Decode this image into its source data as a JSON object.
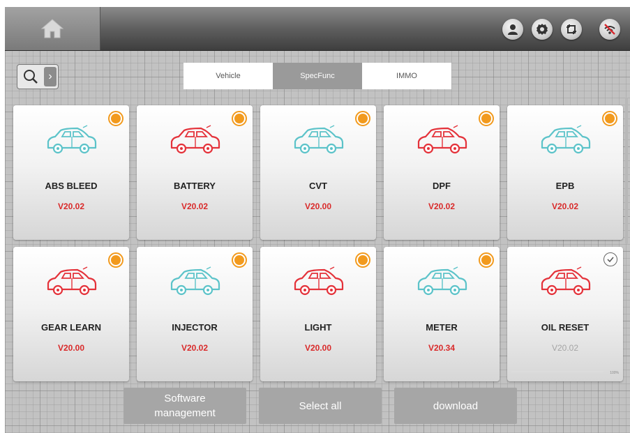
{
  "topbar": {
    "home_icon": "home-icon",
    "icons": [
      "user-icon",
      "gear-icon",
      "screen-capture-icon",
      "wifi-off-icon"
    ]
  },
  "search": {
    "icon": "search-icon",
    "expand_icon": "chevron-right-icon"
  },
  "tabs": [
    {
      "label": "Vehicle",
      "active": false
    },
    {
      "label": "SpecFunc",
      "active": true
    },
    {
      "label": "IMMO",
      "active": false
    }
  ],
  "cards": [
    {
      "name": "ABS BLEED",
      "version": "V20.02",
      "car_color": "#5cc3c9",
      "status": "update"
    },
    {
      "name": "BATTERY",
      "version": "V20.02",
      "car_color": "#e4323a",
      "status": "update"
    },
    {
      "name": "CVT",
      "version": "V20.00",
      "car_color": "#5cc3c9",
      "status": "update"
    },
    {
      "name": "DPF",
      "version": "V20.02",
      "car_color": "#e4323a",
      "status": "update"
    },
    {
      "name": "EPB",
      "version": "V20.02",
      "car_color": "#5cc3c9",
      "status": "update"
    },
    {
      "name": "GEAR LEARN",
      "version": "V20.00",
      "car_color": "#e4323a",
      "status": "update"
    },
    {
      "name": "INJECTOR",
      "version": "V20.02",
      "car_color": "#5cc3c9",
      "status": "update"
    },
    {
      "name": "LIGHT",
      "version": "V20.00",
      "car_color": "#e4323a",
      "status": "update"
    },
    {
      "name": "METER",
      "version": "V20.34",
      "car_color": "#5cc3c9",
      "status": "update"
    },
    {
      "name": "OIL RESET",
      "version": "V20.02",
      "car_color": "#e4323a",
      "status": "installed",
      "progress_percent": 100,
      "progress_label": "100%"
    }
  ],
  "bottom_buttons": [
    {
      "label_line1": "Software",
      "label_line2": "management"
    },
    {
      "label_line1": "Select all",
      "label_line2": ""
    },
    {
      "label_line1": "download",
      "label_line2": ""
    }
  ],
  "colors": {
    "badge_orange": "#f29a1d",
    "version_red": "#d92a2a",
    "car_teal": "#5cc3c9",
    "car_red": "#e4323a"
  }
}
